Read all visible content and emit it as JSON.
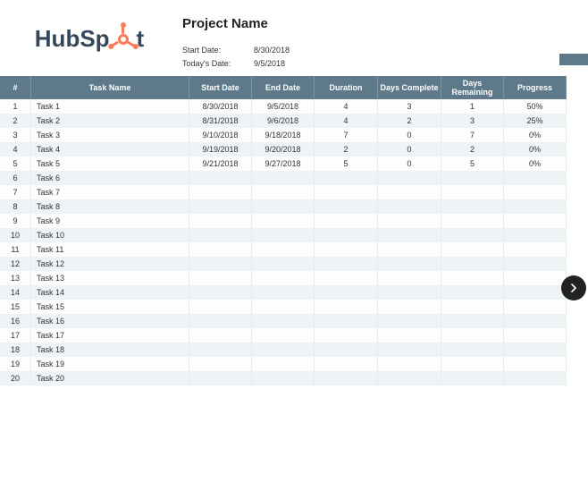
{
  "logo_text_left": "HubSp",
  "logo_text_right": "t",
  "project_title": "Project Name",
  "meta": {
    "start_label": "Start Date:",
    "start_value": "8/30/2018",
    "today_label": "Today's Date:",
    "today_value": "9/5/2018"
  },
  "columns": [
    "#",
    "Task Name",
    "Start Date",
    "End Date",
    "Duration",
    "Days Complete",
    "Days Remaining",
    "Progress"
  ],
  "rows": [
    {
      "n": "1",
      "name": "Task 1",
      "start": "8/30/2018",
      "end": "9/5/2018",
      "dur": "4",
      "dc": "3",
      "dr": "1",
      "prog": "50%"
    },
    {
      "n": "2",
      "name": "Task 2",
      "start": "8/31/2018",
      "end": "9/6/2018",
      "dur": "4",
      "dc": "2",
      "dr": "3",
      "prog": "25%"
    },
    {
      "n": "3",
      "name": "Task 3",
      "start": "9/10/2018",
      "end": "9/18/2018",
      "dur": "7",
      "dc": "0",
      "dr": "7",
      "prog": "0%"
    },
    {
      "n": "4",
      "name": "Task 4",
      "start": "9/19/2018",
      "end": "9/20/2018",
      "dur": "2",
      "dc": "0",
      "dr": "2",
      "prog": "0%"
    },
    {
      "n": "5",
      "name": "Task 5",
      "start": "9/21/2018",
      "end": "9/27/2018",
      "dur": "5",
      "dc": "0",
      "dr": "5",
      "prog": "0%"
    },
    {
      "n": "6",
      "name": "Task 6",
      "start": "",
      "end": "",
      "dur": "",
      "dc": "",
      "dr": "",
      "prog": ""
    },
    {
      "n": "7",
      "name": "Task 7",
      "start": "",
      "end": "",
      "dur": "",
      "dc": "",
      "dr": "",
      "prog": ""
    },
    {
      "n": "8",
      "name": "Task 8",
      "start": "",
      "end": "",
      "dur": "",
      "dc": "",
      "dr": "",
      "prog": ""
    },
    {
      "n": "9",
      "name": "Task 9",
      "start": "",
      "end": "",
      "dur": "",
      "dc": "",
      "dr": "",
      "prog": ""
    },
    {
      "n": "10",
      "name": "Task 10",
      "start": "",
      "end": "",
      "dur": "",
      "dc": "",
      "dr": "",
      "prog": ""
    },
    {
      "n": "11",
      "name": "Task 11",
      "start": "",
      "end": "",
      "dur": "",
      "dc": "",
      "dr": "",
      "prog": ""
    },
    {
      "n": "12",
      "name": "Task 12",
      "start": "",
      "end": "",
      "dur": "",
      "dc": "",
      "dr": "",
      "prog": ""
    },
    {
      "n": "13",
      "name": "Task 13",
      "start": "",
      "end": "",
      "dur": "",
      "dc": "",
      "dr": "",
      "prog": ""
    },
    {
      "n": "14",
      "name": "Task 14",
      "start": "",
      "end": "",
      "dur": "",
      "dc": "",
      "dr": "",
      "prog": ""
    },
    {
      "n": "15",
      "name": "Task 15",
      "start": "",
      "end": "",
      "dur": "",
      "dc": "",
      "dr": "",
      "prog": ""
    },
    {
      "n": "16",
      "name": "Task 16",
      "start": "",
      "end": "",
      "dur": "",
      "dc": "",
      "dr": "",
      "prog": ""
    },
    {
      "n": "17",
      "name": "Task 17",
      "start": "",
      "end": "",
      "dur": "",
      "dc": "",
      "dr": "",
      "prog": ""
    },
    {
      "n": "18",
      "name": "Task 18",
      "start": "",
      "end": "",
      "dur": "",
      "dc": "",
      "dr": "",
      "prog": ""
    },
    {
      "n": "19",
      "name": "Task 19",
      "start": "",
      "end": "",
      "dur": "",
      "dc": "",
      "dr": "",
      "prog": ""
    },
    {
      "n": "20",
      "name": "Task 20",
      "start": "",
      "end": "",
      "dur": "",
      "dc": "",
      "dr": "",
      "prog": ""
    }
  ]
}
